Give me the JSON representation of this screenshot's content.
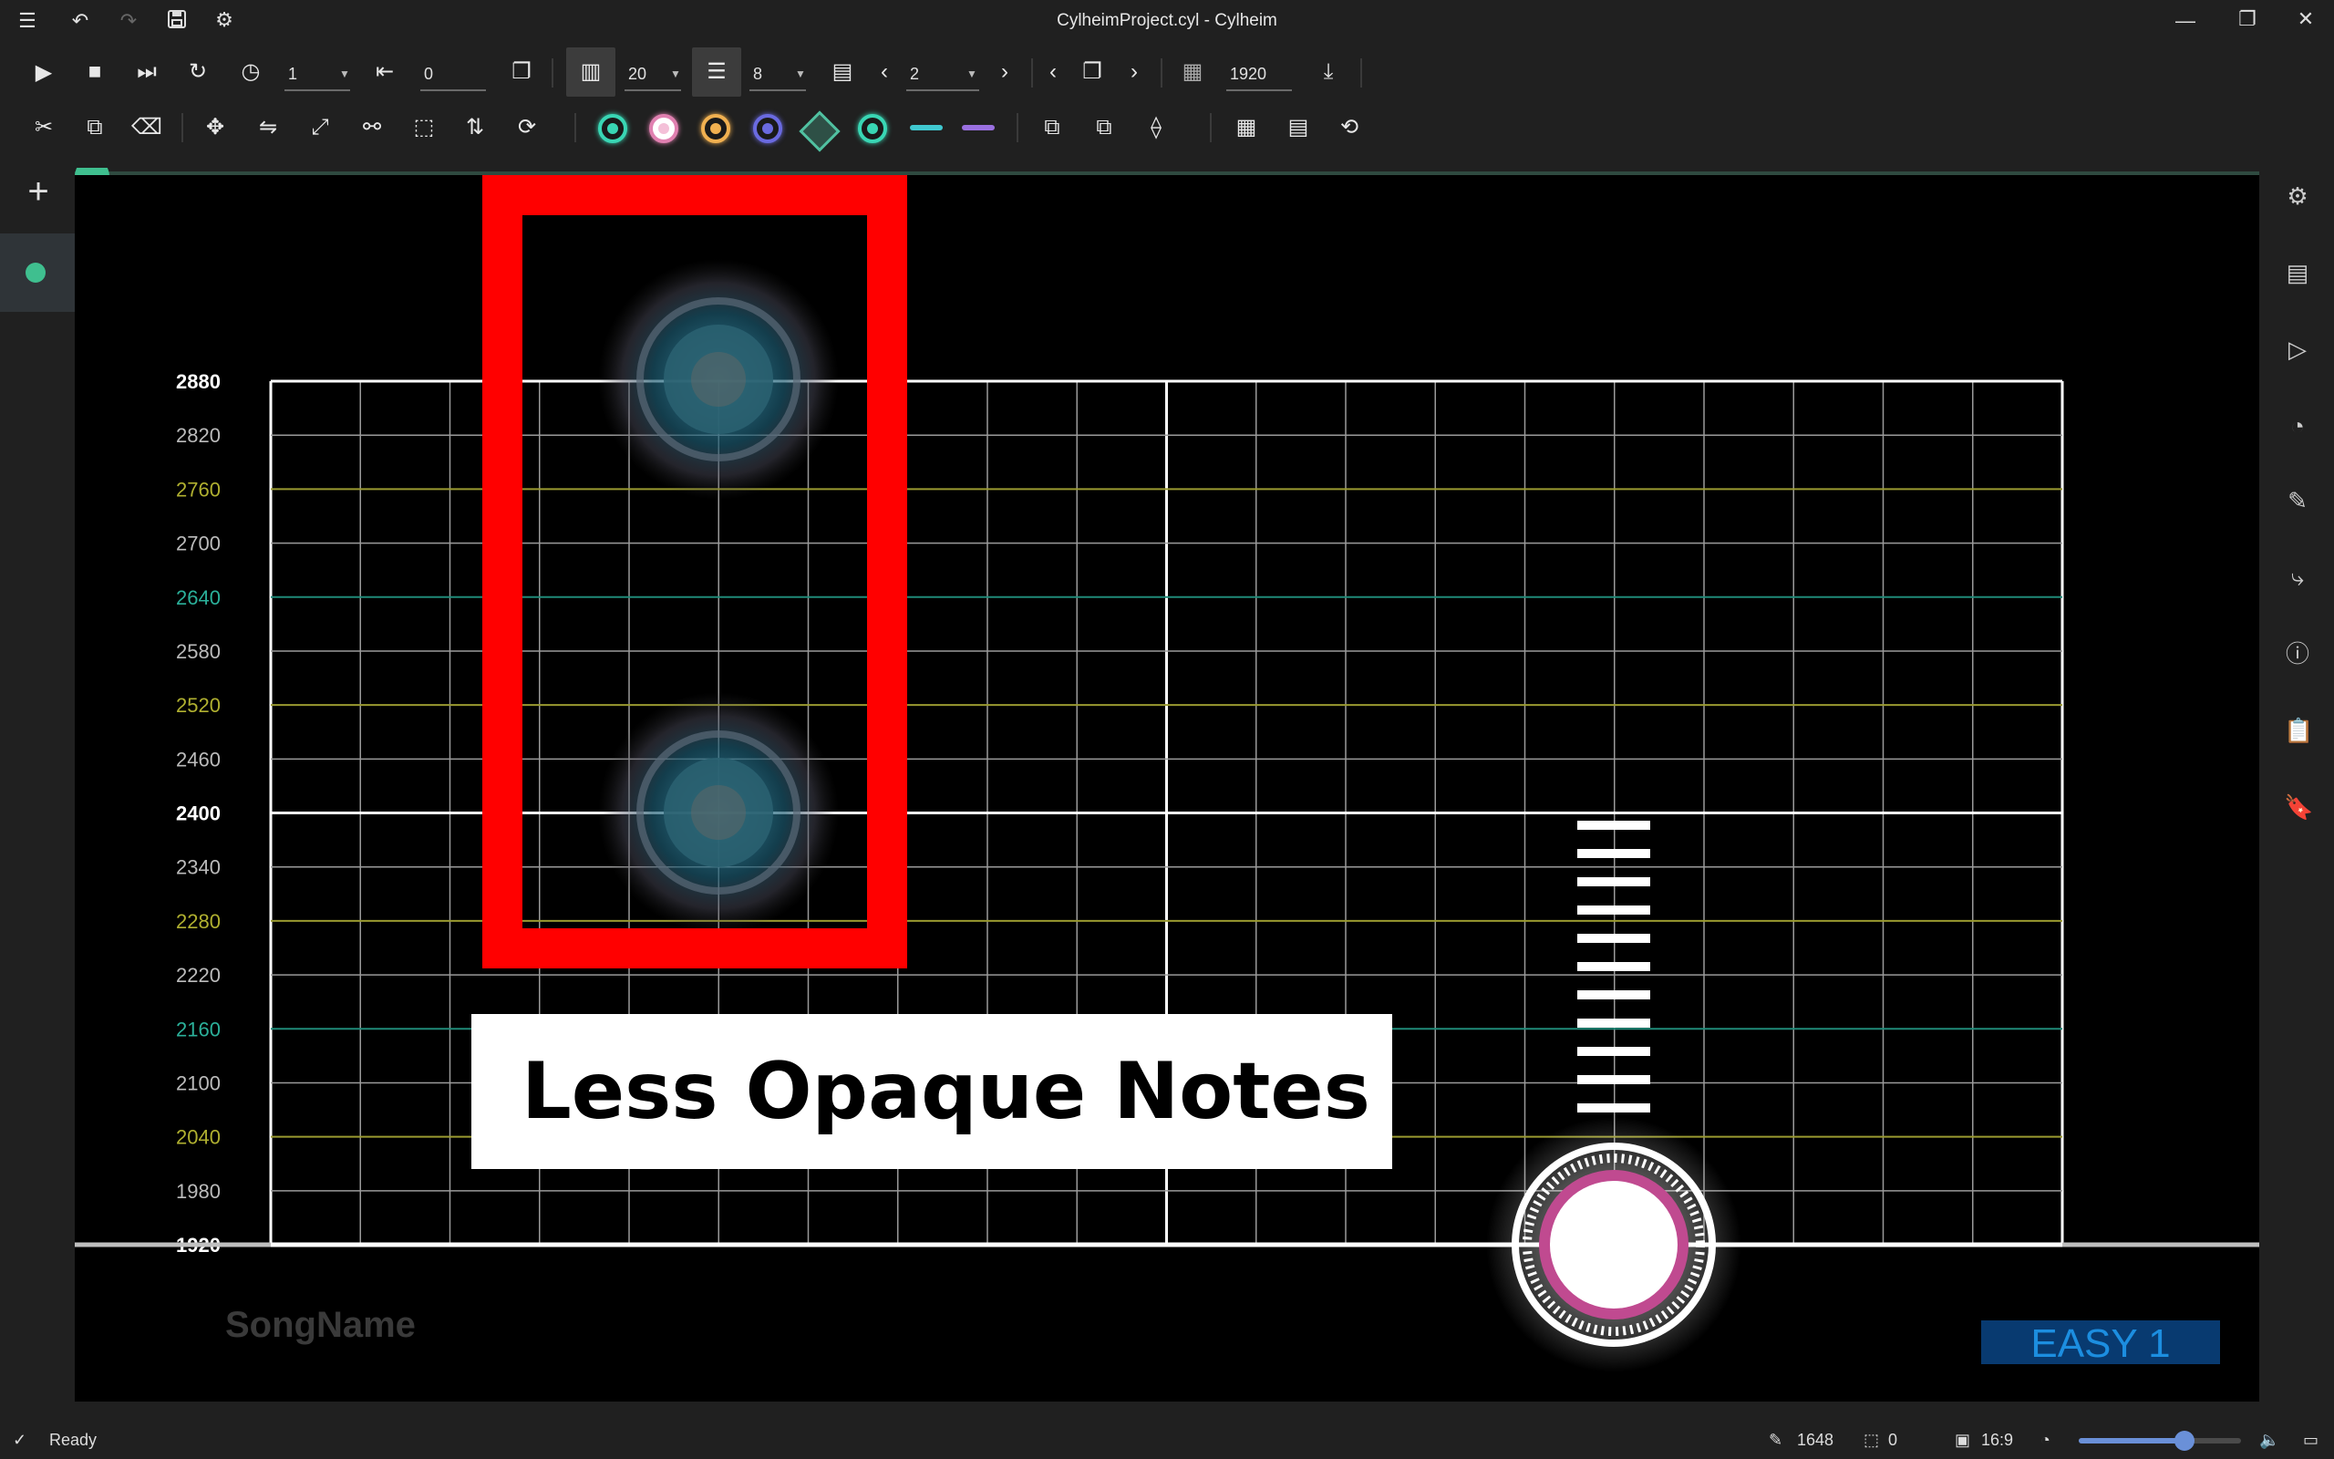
{
  "window": {
    "title": "CylheimProject.cyl - Cylheim",
    "controls": [
      "minimize-icon",
      "maximize-icon",
      "close-icon"
    ]
  },
  "title_toolbar": [
    "menu-icon",
    "undo-icon",
    "redo-icon",
    "save-icon",
    "settings-icon"
  ],
  "toolbar1": {
    "play_speed": "1",
    "offset": "0",
    "columns": "20",
    "rows": "8",
    "page": "2",
    "tick": "1920"
  },
  "toolbar2": {
    "edit_tools": [
      "cut-icon",
      "copy-icon",
      "eraser-icon",
      "move-icon",
      "flip-icon",
      "scale-icon",
      "link-remove-icon",
      "select-icon",
      "swap-icon",
      "rotate-icon"
    ],
    "note_types": [
      {
        "name": "click-note-icon",
        "color": "#39d6b4"
      },
      {
        "name": "hold-note-icon",
        "color": "#e080b0"
      },
      {
        "name": "long-hold-note-icon",
        "color": "#f0b050"
      },
      {
        "name": "drag-head-note-icon",
        "color": "#6a6ae0"
      },
      {
        "name": "flick-note-icon",
        "color": "#50c0a0"
      },
      {
        "name": "click-drag-note-icon",
        "color": "#39d6b4"
      },
      {
        "name": "drag-child-note-icon",
        "color": "#40c8d0"
      },
      {
        "name": "cdrag-child-note-icon",
        "color": "#9a70e0"
      }
    ]
  },
  "chart_view": {
    "y_ticks": [
      "2880",
      "2820",
      "2760",
      "2700",
      "2640",
      "2580",
      "2520",
      "2460",
      "2400",
      "2340",
      "2280",
      "2220",
      "2160",
      "2100",
      "2040",
      "1980",
      "1920"
    ],
    "song_name": "SongName",
    "difficulty": "EASY 1",
    "annotation": "Less Opaque Notes",
    "colors": {
      "accent": "#ff0000",
      "teal_line": "#1f8a78",
      "yellow_line": "#9a9a30",
      "difficulty_bg": "#083a70",
      "difficulty_text": "#1c8ee0"
    }
  },
  "right_panel": [
    "project-settings-icon",
    "chart-properties-icon",
    "playback-icon",
    "statistics-icon",
    "edit-icon",
    "curve-icon",
    "error-icon",
    "clipboard-icon",
    "bookmark-icon"
  ],
  "left_panel": {
    "add_label": "+"
  },
  "status": {
    "message": "Ready",
    "note_count": "1648",
    "selected_count": "0",
    "aspect": "16:9",
    "zoom": 0.65
  }
}
